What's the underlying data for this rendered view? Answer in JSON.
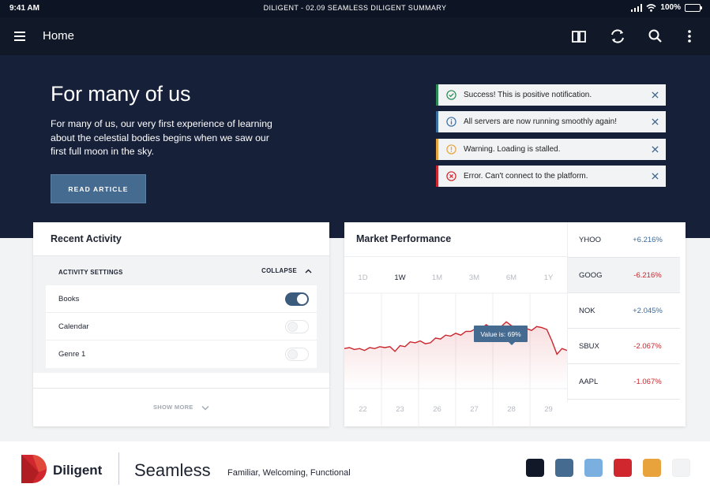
{
  "status_bar": {
    "time": "9:41 AM",
    "title": "DILIGENT - 02.09 SEAMLESS DILIGENT SUMMARY",
    "battery": "100%"
  },
  "app_bar": {
    "title": "Home",
    "icons": [
      "menu-icon",
      "book-icon",
      "sync-icon",
      "search-icon",
      "more-icon"
    ]
  },
  "hero": {
    "heading": "For many of us",
    "body": "For many of us, our very first experience of learning about the celestial bodies begins when we saw our first full moon in the sky.",
    "cta": "READ ARTICLE"
  },
  "notifications": [
    {
      "type": "success",
      "text": "Success! This is positive notification.",
      "color": "#2a8a52"
    },
    {
      "type": "info",
      "text": "All servers are now running smoothly again!",
      "color": "#3b6ea5"
    },
    {
      "type": "warning",
      "text": "Warning. Loading is stalled.",
      "color": "#e8a33c"
    },
    {
      "type": "error",
      "text": "Error. Can't connect to the platform.",
      "color": "#d0262e"
    }
  ],
  "recent_activity": {
    "title": "Recent Activity",
    "settings_label": "ACTIVITY SETTINGS",
    "collapse_label": "COLLAPSE",
    "items": [
      {
        "label": "Books",
        "enabled": true
      },
      {
        "label": "Calendar",
        "enabled": false
      },
      {
        "label": "Genre 1",
        "enabled": false
      }
    ],
    "show_more": "SHOW MORE"
  },
  "market": {
    "title": "Market Performance",
    "ranges": [
      "1D",
      "1W",
      "1M",
      "3M",
      "6M",
      "1Y"
    ],
    "active_range": "1W",
    "tooltip": "Value is: 69%",
    "stocks": [
      {
        "symbol": "YHOO",
        "change": "+6.216%",
        "direction": "up"
      },
      {
        "symbol": "GOOG",
        "change": "-6.216%",
        "direction": "down",
        "selected": true
      },
      {
        "symbol": "NOK",
        "change": "+2.045%",
        "direction": "up"
      },
      {
        "symbol": "SBUX",
        "change": "-2.067%",
        "direction": "down"
      },
      {
        "symbol": "AAPL",
        "change": "-1.067%",
        "direction": "down"
      }
    ]
  },
  "chart_data": {
    "type": "line",
    "x_labels": [
      "22",
      "23",
      "26",
      "27",
      "28",
      "29"
    ],
    "y_range": [
      0,
      100
    ],
    "values": [
      42,
      43,
      41,
      42,
      40,
      43,
      42,
      44,
      43,
      44,
      39,
      45,
      44,
      49,
      48,
      50,
      47,
      48,
      53,
      52,
      56,
      55,
      58,
      56,
      60,
      60,
      63,
      62,
      67,
      64,
      61,
      65,
      70,
      66,
      64,
      65,
      63,
      61,
      65,
      64,
      62,
      50,
      36,
      42,
      40
    ],
    "highlight_value": 69,
    "line_color": "#c9262d"
  },
  "footer": {
    "brand": "Diligent",
    "product": "Seamless",
    "tagline": "Familiar, Welcoming, Functional",
    "palette": [
      "#111929",
      "#456b91",
      "#7aafe0",
      "#d0262e",
      "#e8a33c",
      "#f2f3f5"
    ]
  }
}
